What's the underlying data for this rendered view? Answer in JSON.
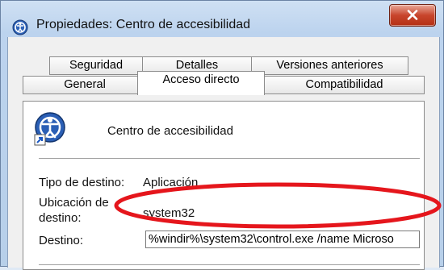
{
  "window": {
    "title": "Propiedades: Centro de accesibilidad",
    "app_icon": "ease-of-access-icon",
    "close_icon": "close-icon"
  },
  "tabs": {
    "row1": [
      {
        "label": "Seguridad"
      },
      {
        "label": "Detalles"
      },
      {
        "label": "Versiones anteriores"
      }
    ],
    "row2": [
      {
        "label": "General"
      },
      {
        "label": "Acceso directo",
        "active": true
      },
      {
        "label": "Compatibilidad"
      }
    ]
  },
  "shortcut": {
    "name": "Centro de accesibilidad",
    "target_type_label": "Tipo de destino:",
    "target_type_value": "Aplicación",
    "target_location_label_line1": "Ubicación de",
    "target_location_label_line2": "destino:",
    "target_location_value": "system32",
    "target_label": "Destino:",
    "target_value": "%windir%\\system32\\control.exe /name Microso"
  },
  "colors": {
    "highlight_ellipse": "#e5161c",
    "close_button": "#c8452c"
  }
}
